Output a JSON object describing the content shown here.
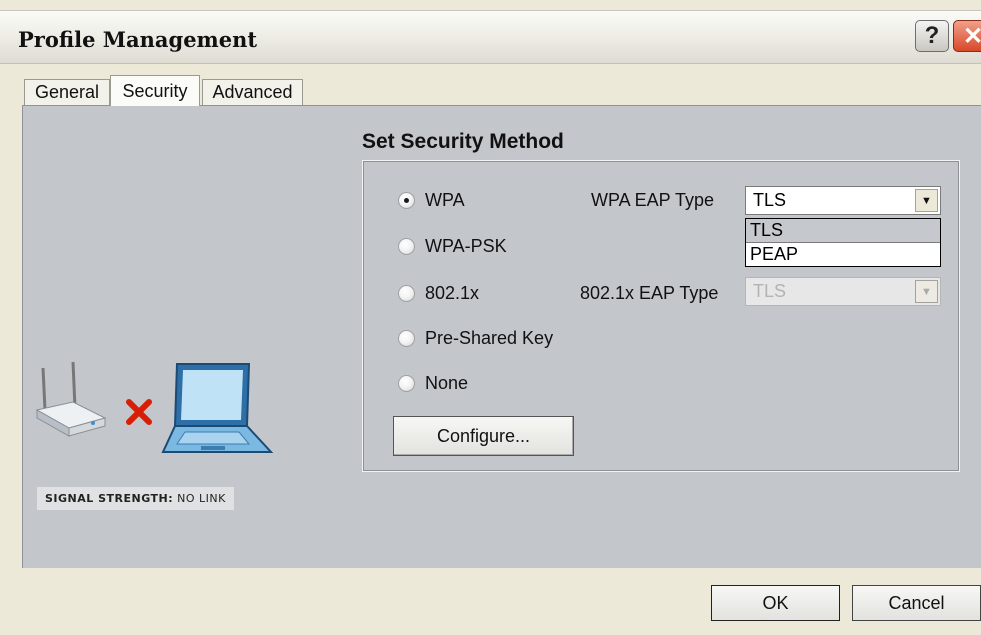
{
  "window": {
    "title": "Profile Management",
    "help_glyph": "?",
    "close_glyph": "✕"
  },
  "tabs": [
    {
      "label": "General"
    },
    {
      "label": "Security"
    },
    {
      "label": "Advanced"
    }
  ],
  "signal": {
    "label": "SIGNAL STRENGTH:",
    "value": "NO LINK"
  },
  "security": {
    "group_title": "Set Security Method",
    "methods": [
      {
        "label": "WPA",
        "checked": true
      },
      {
        "label": "WPA-PSK",
        "checked": false
      },
      {
        "label": "802.1x",
        "checked": false
      },
      {
        "label": "Pre-Shared Key",
        "checked": false
      },
      {
        "label": "None",
        "checked": false
      }
    ],
    "wpa_eap_label": "WPA EAP Type",
    "wpa_eap_value": "TLS",
    "wpa_eap_options": [
      "TLS",
      "PEAP"
    ],
    "dot1x_eap_label": "802.1x EAP Type",
    "dot1x_eap_value": "TLS",
    "configure_label": "Configure..."
  },
  "footer": {
    "ok_label": "OK",
    "cancel_label": "Cancel"
  },
  "icons": {
    "router": "router-icon",
    "no_link": "x-mark-icon",
    "laptop": "laptop-icon",
    "dropdown": "chevron-down-icon"
  },
  "colors": {
    "pane": "#c3c7cb",
    "dialog": "#ece9d8",
    "close_button": "#d8482a",
    "no_link_mark": "#d81e05",
    "laptop": "#5aa5d8"
  }
}
